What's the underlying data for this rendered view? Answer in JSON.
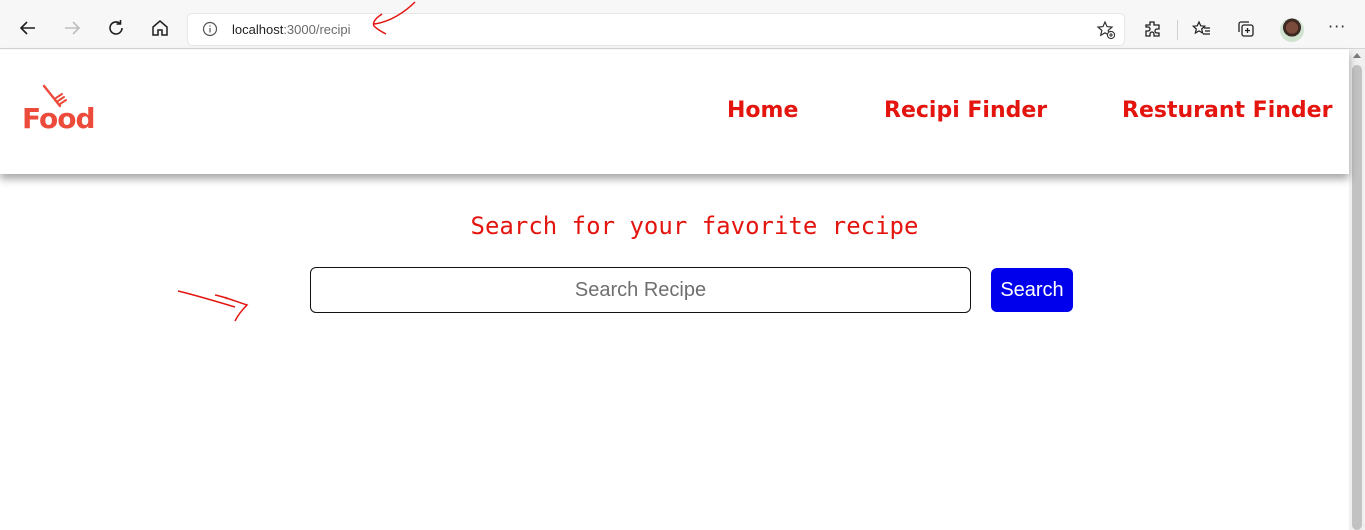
{
  "browser": {
    "url_host": "localhost",
    "url_path": ":3000/recipi",
    "more_label": "···"
  },
  "header": {
    "logo_text": "Food",
    "nav": [
      {
        "label": "Home"
      },
      {
        "label": "Recipi Finder"
      },
      {
        "label": "Resturant Finder"
      }
    ]
  },
  "main": {
    "heading": "Search for your favorite recipe",
    "search_placeholder": "Search Recipe",
    "search_button": "Search"
  },
  "colors": {
    "accent_red": "#e4140f",
    "logo_red": "#ec4b3c",
    "button_blue": "#0000ec"
  },
  "icons": [
    "back-icon",
    "forward-icon",
    "refresh-icon",
    "home-icon",
    "info-icon",
    "favorite-add-icon",
    "extensions-icon",
    "favorites-icon",
    "collections-icon",
    "profile-avatar",
    "more-icon",
    "fork-icon"
  ]
}
